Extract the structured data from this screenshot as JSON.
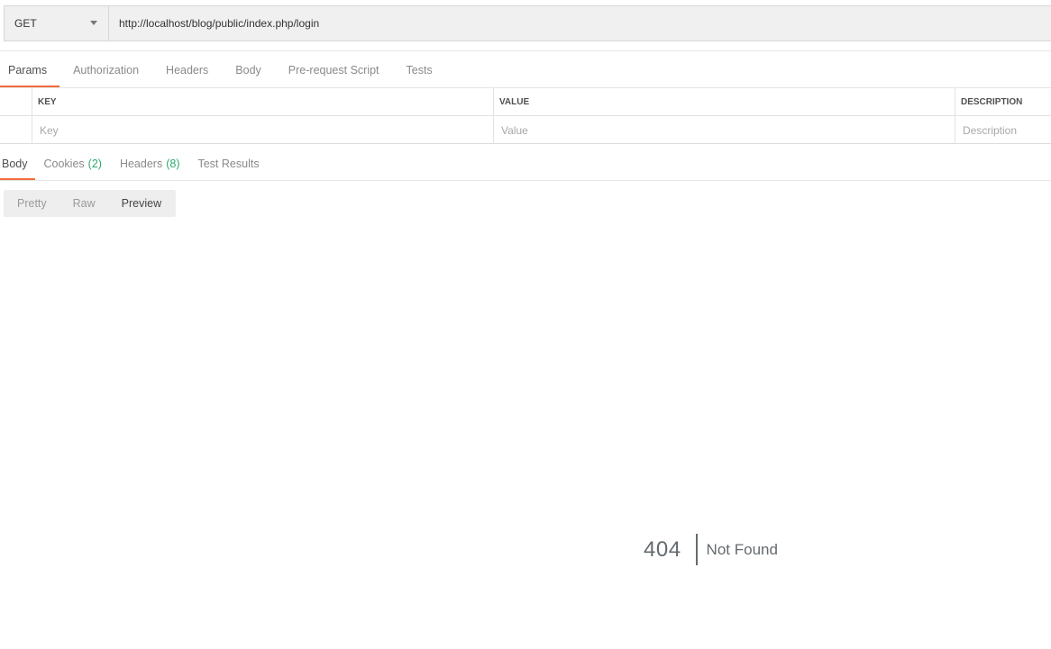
{
  "request": {
    "method": "GET",
    "url": "http://localhost/blog/public/index.php/login"
  },
  "request_tabs": [
    {
      "label": "Params"
    },
    {
      "label": "Authorization"
    },
    {
      "label": "Headers"
    },
    {
      "label": "Body"
    },
    {
      "label": "Pre-request Script"
    },
    {
      "label": "Tests"
    }
  ],
  "params_table": {
    "headers": {
      "key": "KEY",
      "value": "VALUE",
      "description": "DESCRIPTION"
    },
    "placeholders": {
      "key": "Key",
      "value": "Value",
      "description": "Description"
    }
  },
  "response_tabs": {
    "body": "Body",
    "cookies": "Cookies",
    "cookies_count": "(2)",
    "headers": "Headers",
    "headers_count": "(8)",
    "test_results": "Test Results"
  },
  "view_modes": [
    "Pretty",
    "Raw",
    "Preview"
  ],
  "preview": {
    "code": "404",
    "message": "Not Found"
  },
  "colors": {
    "accent": "#f26b3a",
    "count": "#2fa870"
  }
}
